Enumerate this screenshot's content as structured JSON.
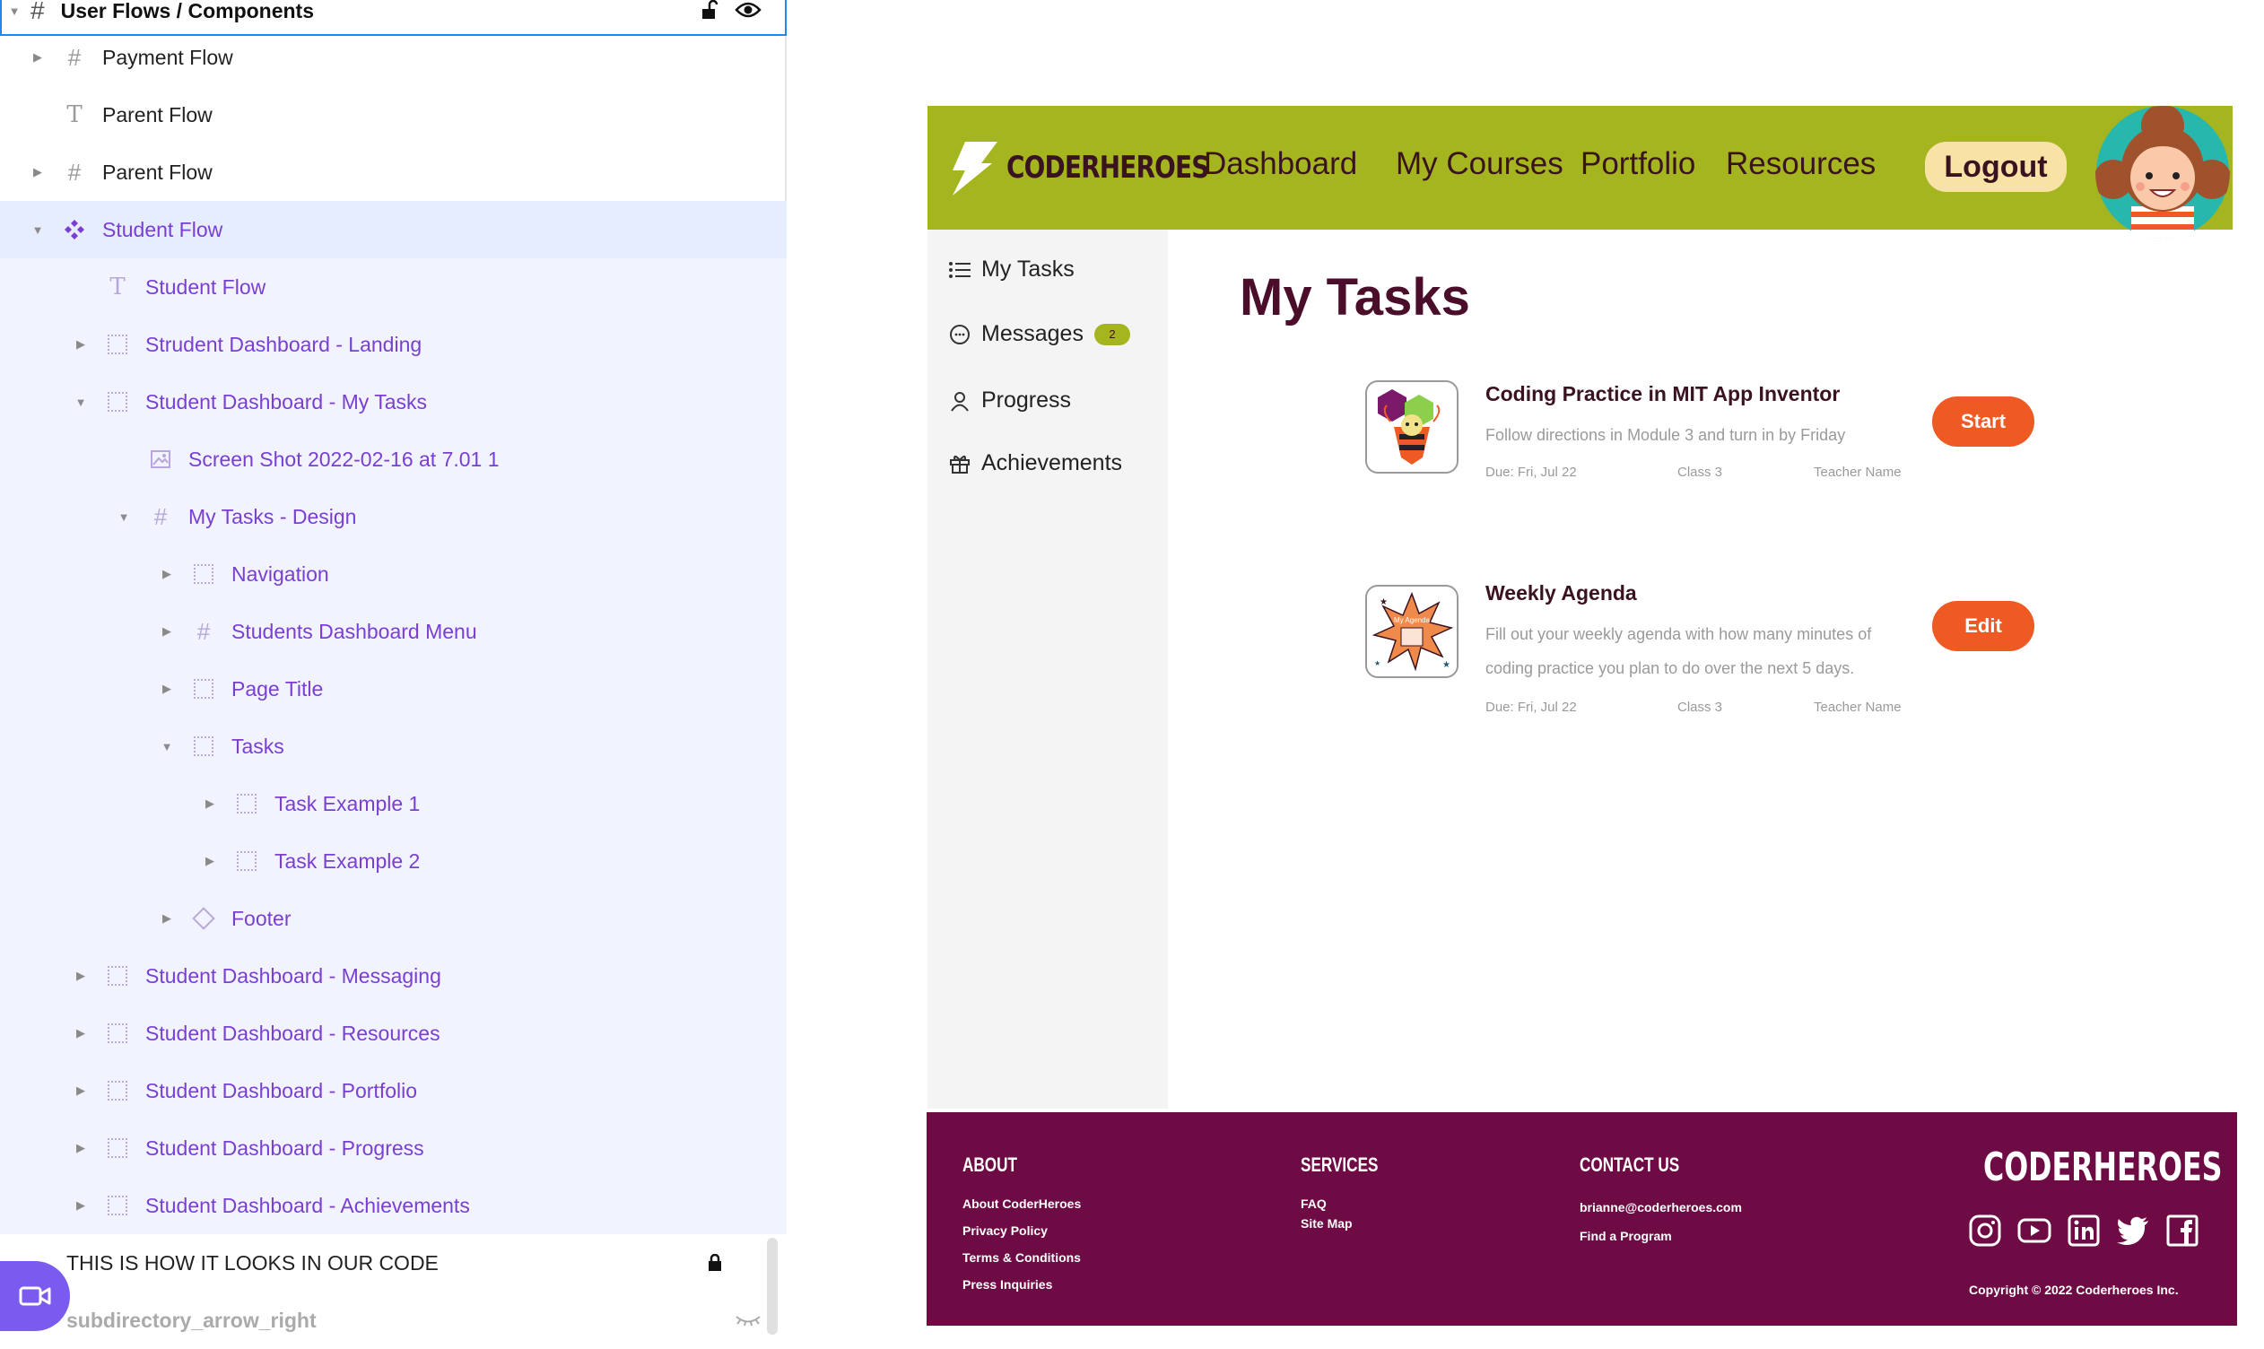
{
  "layers": {
    "header": "User Flows / Components",
    "rows": [
      {
        "label": "Payment Flow"
      },
      {
        "label": "Parent Flow"
      },
      {
        "label": "Parent Flow"
      },
      {
        "label": "Student Flow"
      },
      {
        "label": "Student Flow"
      },
      {
        "label": "Strudent Dashboard - Landing"
      },
      {
        "label": "Student Dashboard - My Tasks"
      },
      {
        "label": "Screen Shot 2022-02-16 at 7.01 1"
      },
      {
        "label": "My Tasks - Design"
      },
      {
        "label": "Navigation"
      },
      {
        "label": "Students Dashboard Menu"
      },
      {
        "label": "Page Title"
      },
      {
        "label": "Tasks"
      },
      {
        "label": "Task Example 1"
      },
      {
        "label": "Task Example 2"
      },
      {
        "label": "Footer"
      },
      {
        "label": "Student Dashboard - Messaging"
      },
      {
        "label": "Student Dashboard - Resources"
      },
      {
        "label": "Student Dashboard - Portfolio"
      },
      {
        "label": "Student Dashboard - Progress"
      },
      {
        "label": "Student Dashboard - Achievements"
      }
    ],
    "bottom": {
      "code_label": "THIS IS HOW IT LOOKS IN OUR CODE",
      "next_label": "subdirectory_arrow_right"
    }
  },
  "site": {
    "brand": "CODERHEROES",
    "nav": {
      "dashboard": "Dashboard",
      "courses": "My Courses",
      "portfolio": "Portfolio",
      "resources": "Resources",
      "logout": "Logout"
    },
    "menu": {
      "tasks": "My Tasks",
      "messages": "Messages",
      "messages_count": "2",
      "progress": "Progress",
      "achievements": "Achievements"
    },
    "page_title": "My Tasks",
    "tasks": [
      {
        "title": "Coding Practice in MIT App Inventor",
        "description": "Follow directions in Module 3 and turn in by Friday",
        "due": "Due:  Fri, Jul 22",
        "class": "Class 3",
        "teacher": "Teacher Name",
        "button": "Start"
      },
      {
        "title": "Weekly Agenda",
        "description": "Fill out your weekly agenda with how many minutes of coding practice you plan to do over the next 5 days.",
        "due": "Due:  Fri, Jul 22",
        "class": "Class 3",
        "teacher": "Teacher Name",
        "button": "Edit",
        "icon_caption": "My Agenda"
      }
    ],
    "footer": {
      "about_head": "ABOUT",
      "about_links": [
        "About CoderHeroes",
        "Privacy Policy",
        "Terms & Conditions",
        "Press Inquiries"
      ],
      "services_head": "SERVICES",
      "services_links": [
        "FAQ",
        "Site Map"
      ],
      "contact_head": "CONTACT US",
      "contact_links": [
        "brianne@coderheroes.com",
        "Find a Program"
      ],
      "brand": "CODERHEROES",
      "copyright": "Copyright © 2022 Coderheroes Inc."
    }
  },
  "colors": {
    "nav_bg": "#a5b51f",
    "footer_bg": "#6e0b45",
    "accent_orange": "#ef5a24",
    "layer_purple": "#7a3fd2",
    "selection_blue": "#1e8af0"
  }
}
